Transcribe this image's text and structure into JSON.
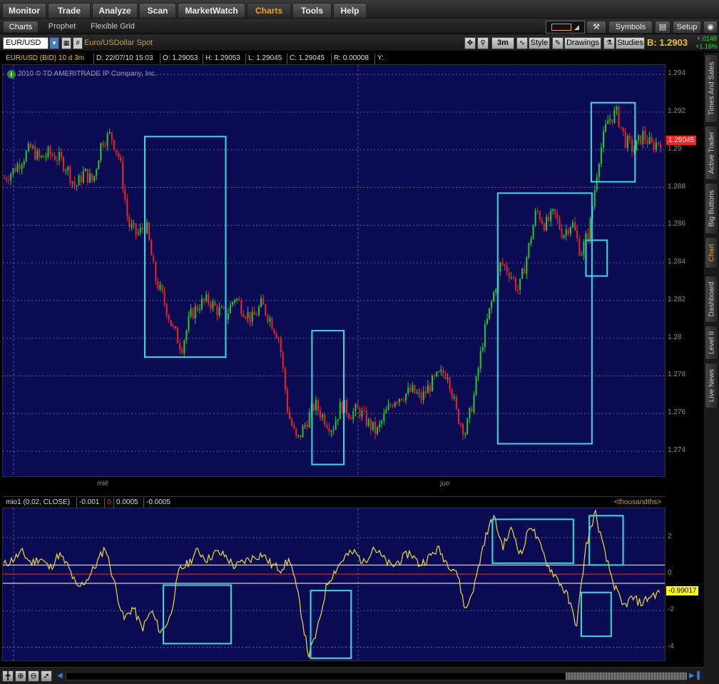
{
  "nav": {
    "tabs": [
      {
        "label": "Monitor",
        "active": false
      },
      {
        "label": "Trade",
        "active": false
      },
      {
        "label": "Analyze",
        "active": false
      },
      {
        "label": "Scan",
        "active": false
      },
      {
        "label": "MarketWatch",
        "active": false
      },
      {
        "label": "Charts",
        "active": true
      },
      {
        "label": "Tools",
        "active": false
      },
      {
        "label": "Help",
        "active": false
      }
    ]
  },
  "subnav": {
    "tabs": [
      {
        "label": "Charts",
        "active": true
      },
      {
        "label": "Prophet",
        "active": false
      },
      {
        "label": "Flexible Grid",
        "active": false
      }
    ],
    "symbols_label": "Symbols",
    "setup_label": "Setup"
  },
  "toolbar": {
    "symbol_value": "EUR/USD",
    "description": "Euro/USDollar Spot",
    "aggregation": "3m",
    "style_label": "Style",
    "drawings_label": "Drawings",
    "studies_label": "Studies",
    "bid_label": "B: 1.2903",
    "change_abs": "+.0148",
    "change_pct": "+1.16%"
  },
  "infobar": {
    "title": "EUR/USD (BID) 10 d 3m",
    "date": "D: 22/07/10 15:03",
    "open": "O: 1.29053",
    "high": "H: 1.29053",
    "low": "L: 1.29045",
    "close": "C: 1.29045",
    "range": "R: 0.00008",
    "y": "Y:"
  },
  "copyright": "2010 © TD AMERITRADE IP Company, Inc.",
  "main_axis": {
    "ticks": [
      "1.294",
      "1.292",
      "1.29",
      "1.288",
      "1.286",
      "1.284",
      "1.282",
      "1.28",
      "1.278",
      "1.276",
      "1.274"
    ],
    "last_price": "1.29045"
  },
  "time_axis": {
    "labels": [
      "mié",
      "jue"
    ]
  },
  "lower": {
    "study_label": "mio1 (0.02, CLOSE)",
    "v1": "-0.001",
    "v2": "0",
    "v3": "0.0005",
    "v4": "-0.0005",
    "units": "<thousandths>",
    "ticks": [
      "2",
      "0",
      "-2",
      "-4"
    ],
    "last_value": "-0.99017"
  },
  "sidebar": {
    "tabs": [
      {
        "label": "Times And Sales",
        "active": false
      },
      {
        "label": "Active Trader",
        "active": false
      },
      {
        "label": "Big Buttons",
        "active": false
      },
      {
        "label": "Chart",
        "active": true
      },
      {
        "label": "Dashboard",
        "active": false
      },
      {
        "label": "Level II",
        "active": false
      },
      {
        "label": "Live News",
        "active": false
      }
    ]
  },
  "colors": {
    "background": "#0b0b54",
    "up_candle": "#22cc22",
    "down_candle": "#ee2222",
    "highlight_box": "#33dddd",
    "study_line": "#eedd33",
    "price_tag": "#ff2020",
    "accent": "#f0a020"
  },
  "chart_data": [
    {
      "type": "candlestick",
      "title": "EUR/USD (BID) 10 d 3m",
      "ylim": [
        1.2726,
        1.2945
      ],
      "x_labels": [
        "mié",
        "jue"
      ],
      "close_path": [
        1.2885,
        1.2889,
        1.2895,
        1.2901,
        1.2895,
        1.2898,
        1.2896,
        1.2891,
        1.288,
        1.2888,
        1.2883,
        1.2905,
        1.2908,
        1.2895,
        1.286,
        1.2855,
        1.286,
        1.2832,
        1.282,
        1.2805,
        1.2795,
        1.2812,
        1.2818,
        1.282,
        1.2815,
        1.2812,
        1.2822,
        1.2815,
        1.281,
        1.2818,
        1.281,
        1.28,
        1.276,
        1.2745,
        1.2755,
        1.2765,
        1.2758,
        1.2752,
        1.2765,
        1.276,
        1.2762,
        1.2755,
        1.275,
        1.276,
        1.2768,
        1.277,
        1.2772,
        1.2768,
        1.2775,
        1.278,
        1.2782,
        1.276,
        1.275,
        1.277,
        1.28,
        1.282,
        1.284,
        1.2835,
        1.2825,
        1.2845,
        1.2868,
        1.286,
        1.2866,
        1.2855,
        1.2862,
        1.2845,
        1.2858,
        1.2895,
        1.2915,
        1.292,
        1.2905,
        1.29,
        1.2908,
        1.2902,
        1.2905
      ],
      "highlight_boxes": [
        {
          "x0": 0.214,
          "x1": 0.336,
          "y_top": 1.2907,
          "y_bottom": 1.279
        },
        {
          "x0": 0.466,
          "x1": 0.514,
          "y_top": 1.2804,
          "y_bottom": 1.2733
        },
        {
          "x0": 0.746,
          "x1": 0.888,
          "y_top": 1.2877,
          "y_bottom": 1.2744
        },
        {
          "x0": 0.879,
          "x1": 0.911,
          "y_top": 1.2852,
          "y_bottom": 1.2833
        },
        {
          "x0": 0.887,
          "x1": 0.953,
          "y_top": 1.2925,
          "y_bottom": 1.2883
        }
      ],
      "last_price": 1.29045
    },
    {
      "type": "line",
      "series": [
        {
          "name": "mio1 (0.02, CLOSE)",
          "values": [
            0.5,
            0.8,
            1.2,
            0.6,
            0.9,
            0.3,
            1.1,
            0.4,
            -0.8,
            -0.3,
            0.5,
            1.5,
            -0.5,
            -2.5,
            -1.8,
            -3.0,
            -2.0,
            -3.2,
            -2.4,
            0.2,
            0.6,
            1.3,
            0.8,
            1.2,
            1.0,
            0.4,
            0.7,
            0.9,
            1.1,
            0.5,
            0.3,
            0.8,
            -1.5,
            -4.5,
            -3.0,
            -0.5,
            0.3,
            1.0,
            1.2,
            0.6,
            1.5,
            0.9,
            0.4,
            0.8,
            1.2,
            0.5,
            0.9,
            1.4,
            0.6,
            0.2,
            -2.0,
            -0.5,
            1.8,
            3.2,
            1.5,
            2.5,
            1.0,
            2.8,
            1.6,
            0.4,
            -0.3,
            -1.2,
            -2.8,
            1.5,
            3.4,
            1.2,
            -0.5,
            -1.8,
            -1.3,
            -1.6,
            -1.2,
            -0.99
          ]
        }
      ],
      "ylim": [
        -4.8,
        3.6
      ],
      "reference_lines": [
        0.5,
        0.0,
        -0.5
      ],
      "y_ticks": [
        2,
        0,
        -2,
        -4
      ],
      "y_unit": "<thousandths>",
      "highlight_boxes": [
        {
          "x0": 0.242,
          "x1": 0.344,
          "y_top": -0.6,
          "y_bottom": -3.8
        },
        {
          "x0": 0.464,
          "x1": 0.525,
          "y_top": -0.9,
          "y_bottom": -4.6
        },
        {
          "x0": 0.738,
          "x1": 0.86,
          "y_top": 3.0,
          "y_bottom": 0.6
        },
        {
          "x0": 0.872,
          "x1": 0.917,
          "y_top": -1.0,
          "y_bottom": -3.4
        },
        {
          "x0": 0.884,
          "x1": 0.935,
          "y_top": 3.2,
          "y_bottom": 0.5
        }
      ],
      "last_value": -0.99017
    }
  ]
}
